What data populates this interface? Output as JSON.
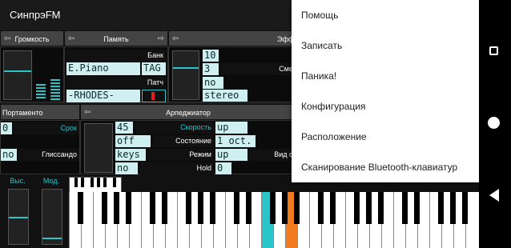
{
  "app": {
    "title": "СинпрэFM"
  },
  "headers": {
    "volume": "Громкость",
    "memory": "Память",
    "effects": "Эфф",
    "portamento": "Портаменто",
    "arpeggiator": "Арпеджиатор"
  },
  "memory": {
    "bank_label": "Банк",
    "bank_value": "E.Piano",
    "tag_button": "TAG",
    "patch_label": "Патч",
    "patch_value": "-RHODES-"
  },
  "effects": {
    "value1": "10",
    "value2": "3",
    "mix_label": "Сме",
    "value3": "no",
    "value4": "stereo"
  },
  "portamento": {
    "time_value": "0",
    "time_label": "Срок",
    "glide_value": "no",
    "glide_label": "Глиссандо"
  },
  "arpeggiator": {
    "rows": [
      {
        "value": "45",
        "label": "Скорость",
        "value2": "up",
        "label_color": "cyan"
      },
      {
        "value": "off",
        "label": "Состояние",
        "value2": "1 oct.",
        "label_color": "white"
      },
      {
        "value": "keys",
        "label": "Режим",
        "value2": "up",
        "label_color": "white",
        "extra_label": "Вид о"
      },
      {
        "value": "no",
        "label": "Hold",
        "value2": "0",
        "label_color": "white"
      }
    ]
  },
  "wheels": {
    "pitch_label": "Выс.",
    "mod_label": "Мод."
  },
  "menu": {
    "items": [
      "Помощь",
      "Записать",
      "Паника!",
      "Конфигурация",
      "Расположение",
      "Сканирование Bluetooth-клавиатур"
    ]
  },
  "colors": {
    "accent": "#29c5c9",
    "orange": "#f27b1d",
    "lcd": "#cfeff0"
  }
}
